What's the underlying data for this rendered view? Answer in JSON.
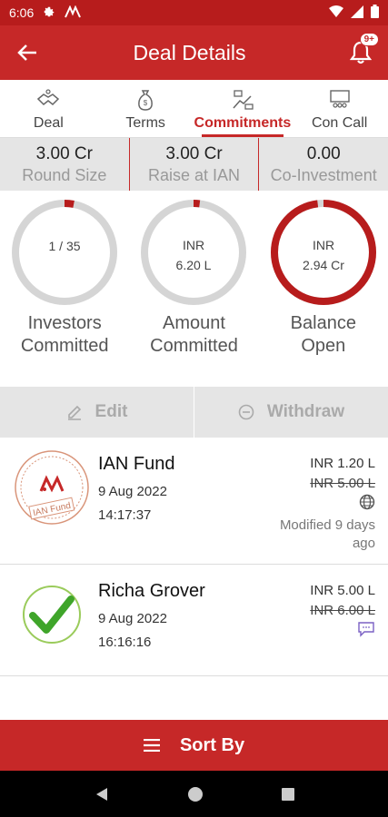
{
  "status_bar": {
    "time": "6:06"
  },
  "app_bar": {
    "title": "Deal Details",
    "badge": "9+"
  },
  "tabs": [
    {
      "label": "Deal",
      "icon": "handshake-icon"
    },
    {
      "label": "Terms",
      "icon": "money-bag-icon"
    },
    {
      "label": "Commitments",
      "icon": "commitment-icon",
      "active": true
    },
    {
      "label": "Con Call",
      "icon": "conference-icon"
    }
  ],
  "stats": [
    {
      "value": "3.00 Cr",
      "label": "Round Size"
    },
    {
      "value": "3.00 Cr",
      "label": "Raise at IAN"
    },
    {
      "value": "0.00",
      "label": "Co-Investment"
    }
  ],
  "rings": [
    {
      "line1": "1 / 35",
      "line2": "",
      "label1": "Investors",
      "label2": "Committed",
      "progress": 0.03
    },
    {
      "line1": "INR",
      "line2": "6.20 L",
      "label1": "Amount",
      "label2": "Committed",
      "progress": 0.02
    },
    {
      "line1": "INR",
      "line2": "2.94 Cr",
      "label1": "Balance",
      "label2": "Open",
      "progress": 0.98
    }
  ],
  "actions": {
    "edit": "Edit",
    "withdraw": "Withdraw"
  },
  "commitments": [
    {
      "name": "IAN Fund",
      "date": "9 Aug 2022",
      "time": "14:17:37",
      "amount": "INR  1.20 L",
      "old_amount": "INR  5.00 L",
      "modified": "Modified 9 days ago",
      "stamp_text": "IAN Fund",
      "icon": "globe-icon"
    },
    {
      "name": "Richa Grover",
      "date": "9 Aug 2022",
      "time": "16:16:16",
      "amount": "INR  5.00 L",
      "old_amount": "INR  6.00 L",
      "modified": "",
      "icon": "chat-icon"
    }
  ],
  "sort": {
    "label": "Sort By"
  },
  "colors": {
    "primary": "#c62828",
    "ring_track": "#d5d5d5",
    "ring_progress": "#b71c1c"
  }
}
